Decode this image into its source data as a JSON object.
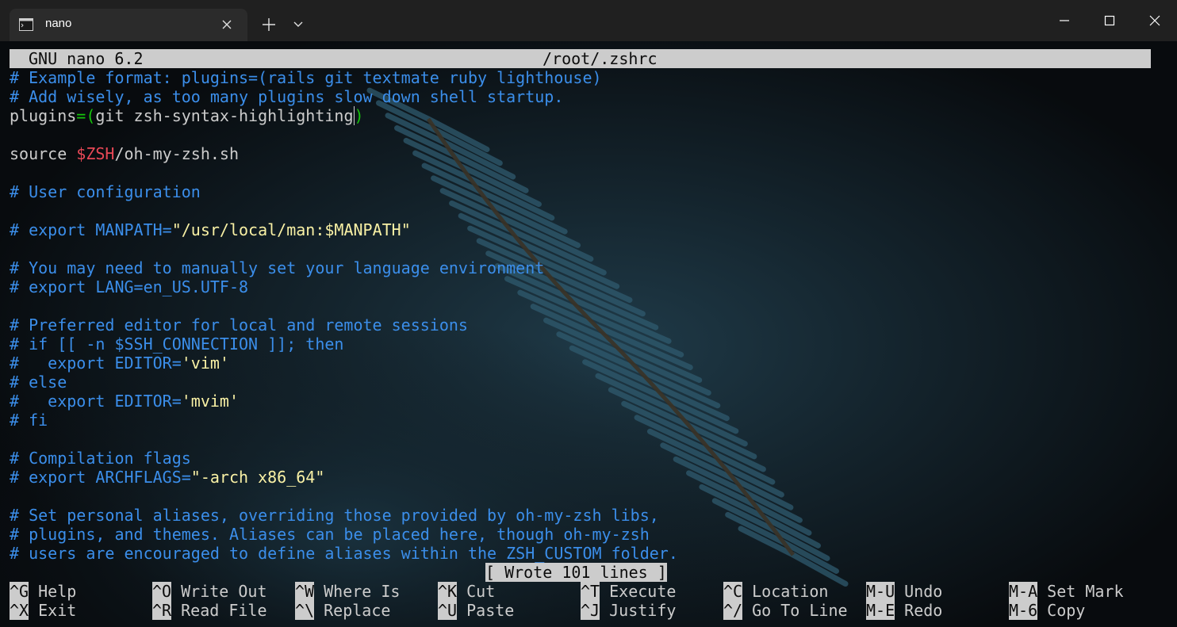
{
  "window": {
    "tab_title": "nano",
    "accent": "#202020"
  },
  "nano": {
    "version": "GNU nano 6.2",
    "filename": "/root/.zshrc",
    "status": "[ Wrote 101 lines ]"
  },
  "lines": [
    [
      {
        "t": "# Example format: plugins=(rails git textmate ruby lighthouse)",
        "c": "cm"
      }
    ],
    [
      {
        "t": "# Add wisely, as too many plugins slow down shell startup.",
        "c": "cm"
      }
    ],
    [
      {
        "t": "plugins",
        "c": "tx"
      },
      {
        "t": "=(",
        "c": "gr"
      },
      {
        "t": "git zsh-syntax-highlighting",
        "c": "tx"
      },
      {
        "t": ")",
        "c": "gr"
      }
    ],
    [],
    [
      {
        "t": "source ",
        "c": "tx"
      },
      {
        "t": "$ZSH",
        "c": "vr"
      },
      {
        "t": "/oh-my-zsh.sh",
        "c": "tx"
      }
    ],
    [],
    [
      {
        "t": "# User configuration",
        "c": "cm"
      }
    ],
    [],
    [
      {
        "t": "# export MANPATH=",
        "c": "cm"
      },
      {
        "t": "\"/usr/local/man:$MANPATH\"",
        "c": "st"
      }
    ],
    [],
    [
      {
        "t": "# You may need to manually set your language environment",
        "c": "cm"
      }
    ],
    [
      {
        "t": "# export LANG=en_US.UTF-8",
        "c": "cm"
      }
    ],
    [],
    [
      {
        "t": "# Preferred editor for local and remote sessions",
        "c": "cm"
      }
    ],
    [
      {
        "t": "# if [[ -n $SSH_CONNECTION ]]; then",
        "c": "cm"
      }
    ],
    [
      {
        "t": "#   export EDITOR=",
        "c": "cm"
      },
      {
        "t": "'vim'",
        "c": "st"
      }
    ],
    [
      {
        "t": "# else",
        "c": "cm"
      }
    ],
    [
      {
        "t": "#   export EDITOR=",
        "c": "cm"
      },
      {
        "t": "'mvim'",
        "c": "st"
      }
    ],
    [
      {
        "t": "# fi",
        "c": "cm"
      }
    ],
    [],
    [
      {
        "t": "# Compilation flags",
        "c": "cm"
      }
    ],
    [
      {
        "t": "# export ARCHFLAGS=",
        "c": "cm"
      },
      {
        "t": "\"-arch x86_64\"",
        "c": "st"
      }
    ],
    [],
    [
      {
        "t": "# Set personal aliases, overriding those provided by oh-my-zsh libs,",
        "c": "cm"
      }
    ],
    [
      {
        "t": "# plugins, and themes. Aliases can be placed here, though oh-my-zsh",
        "c": "cm"
      }
    ],
    [
      {
        "t": "# users are encouraged to define aliases within the ZSH_CUSTOM folder.",
        "c": "cm"
      }
    ]
  ],
  "shortcuts": [
    [
      {
        "key": "^G",
        "label": "Help"
      },
      {
        "key": "^O",
        "label": "Write Out"
      },
      {
        "key": "^W",
        "label": "Where Is"
      },
      {
        "key": "^K",
        "label": "Cut"
      },
      {
        "key": "^T",
        "label": "Execute"
      },
      {
        "key": "^C",
        "label": "Location"
      },
      {
        "key": "M-U",
        "label": "Undo"
      },
      {
        "key": "M-A",
        "label": "Set Mark"
      }
    ],
    [
      {
        "key": "^X",
        "label": "Exit"
      },
      {
        "key": "^R",
        "label": "Read File"
      },
      {
        "key": "^\\",
        "label": "Replace"
      },
      {
        "key": "^U",
        "label": "Paste"
      },
      {
        "key": "^J",
        "label": "Justify"
      },
      {
        "key": "^/",
        "label": "Go To Line"
      },
      {
        "key": "M-E",
        "label": "Redo"
      },
      {
        "key": "M-6",
        "label": "Copy"
      }
    ]
  ],
  "icons": {
    "tab": "terminal-icon",
    "close": "close-icon",
    "new_tab": "plus-icon",
    "dropdown": "chevron-down-icon",
    "minimize": "minimize-icon",
    "maximize": "maximize-icon",
    "window_close": "window-close-icon"
  }
}
